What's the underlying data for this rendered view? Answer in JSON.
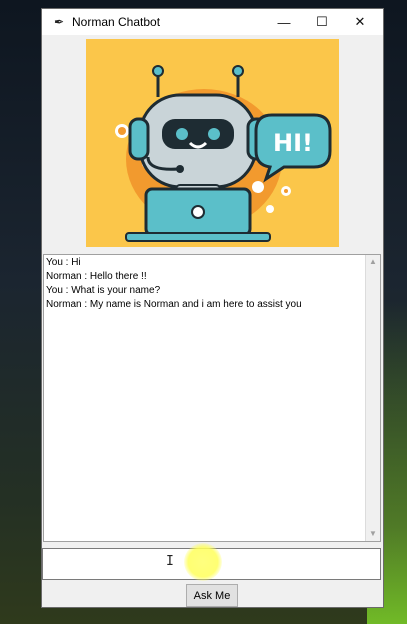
{
  "window": {
    "title": "Norman Chatbot",
    "controls": {
      "minimize": "—",
      "maximize": "☐",
      "close": "✕"
    }
  },
  "banner": {
    "speech_text": "HI!",
    "colors": {
      "background": "#fbc64a",
      "accent": "#5bbfc9",
      "dark": "#1e2c33"
    }
  },
  "chat": {
    "log": "You : Hi\nNorman : Hello there !!\nYou : What is your name?\nNorman : My name is Norman and i am here to assist you"
  },
  "input": {
    "value": ""
  },
  "button": {
    "label": "Ask Me"
  },
  "cursor": {
    "glyph": "I"
  }
}
